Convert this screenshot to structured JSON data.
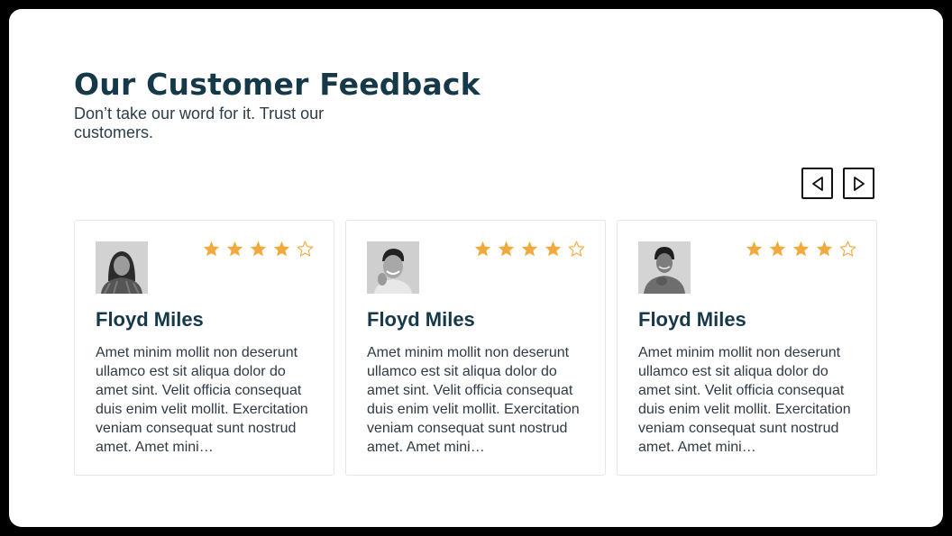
{
  "header": {
    "title": "Our Customer Feedback",
    "subtitle": "Don’t take our word for it. Trust our customers."
  },
  "carousel": {
    "prev_icon": "chevron-left-icon",
    "next_icon": "chevron-right-icon"
  },
  "colors": {
    "title": "#16394a",
    "star_filled": "#f2a93b",
    "card_border": "#e3e6ea"
  },
  "testimonials": [
    {
      "name": "Floyd Miles",
      "rating": 4,
      "max_rating": 5,
      "text": "Amet minim mollit non deserunt ullamco est sit aliqua dolor do amet sint. Velit officia consequat duis enim velit mollit. Exercitation veniam consequat sunt nostrud amet. Amet mini…"
    },
    {
      "name": "Floyd Miles",
      "rating": 4,
      "max_rating": 5,
      "text": "Amet minim mollit non deserunt ullamco est sit aliqua dolor do amet sint. Velit officia consequat duis enim velit mollit. Exercitation veniam consequat sunt nostrud amet. Amet mini…"
    },
    {
      "name": "Floyd Miles",
      "rating": 4,
      "max_rating": 5,
      "text": "Amet minim mollit non deserunt ullamco est sit aliqua dolor do amet sint. Velit officia consequat duis enim velit mollit. Exercitation veniam consequat sunt nostrud amet. Amet mini…"
    }
  ]
}
